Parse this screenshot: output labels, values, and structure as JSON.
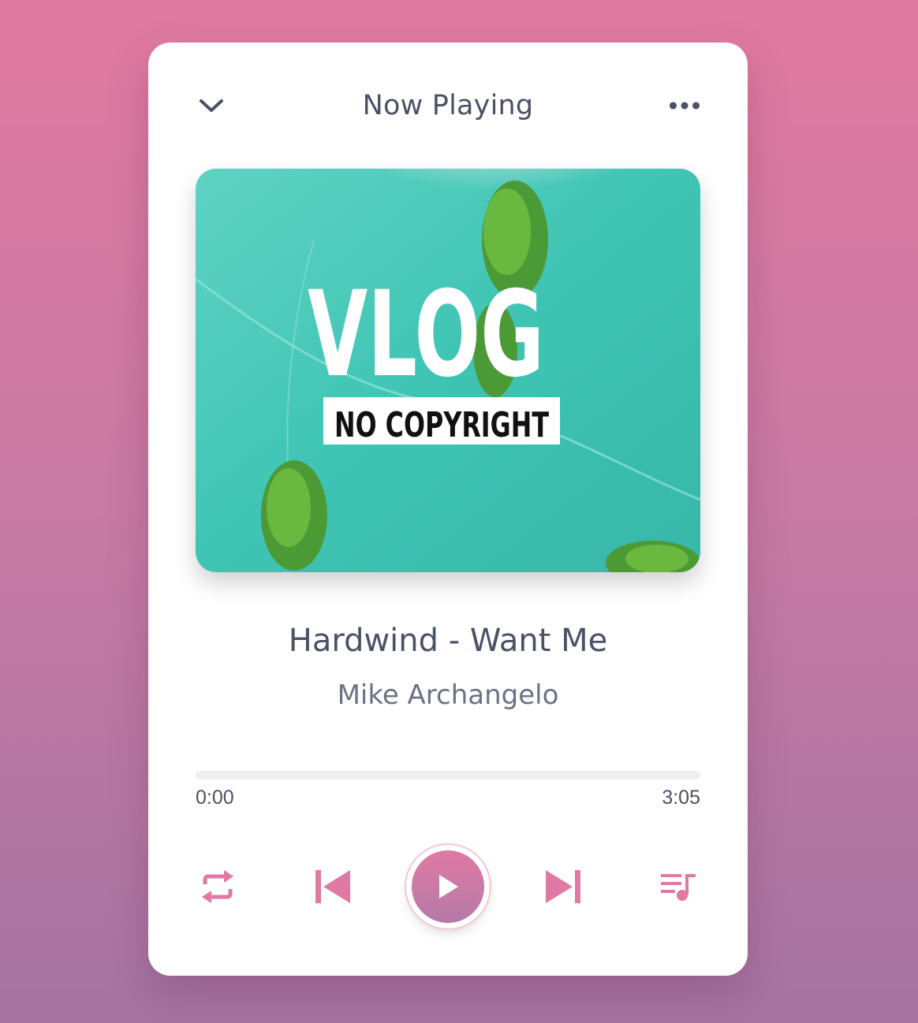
{
  "header": {
    "title": "Now Playing",
    "collapse_icon": "chevron-down-icon",
    "menu_icon": "more-horizontal-icon"
  },
  "album_art": {
    "main_text": "VLOG",
    "sub_text": "NO COPYRIGHT"
  },
  "track": {
    "title": "Hardwind - Want Me",
    "artist": "Mike Archangelo"
  },
  "progress": {
    "current_time": "0:00",
    "total_time": "3:05",
    "fraction": 0
  },
  "controls": {
    "repeat_icon": "repeat-icon",
    "previous_icon": "skip-previous-icon",
    "play_icon": "play-icon",
    "next_icon": "skip-next-icon",
    "playlist_icon": "playlist-icon"
  },
  "colors": {
    "accent": "#e07aa3",
    "text": "#4a5266",
    "background_top": "#e27aa0",
    "background_bottom": "#a574a1"
  }
}
